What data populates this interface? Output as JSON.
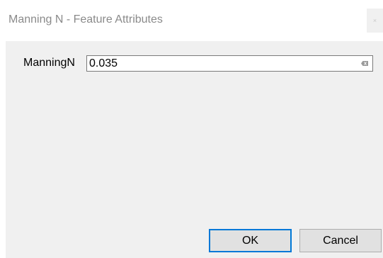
{
  "window": {
    "title": "Manning N - Feature Attributes",
    "close_glyph": "×"
  },
  "form": {
    "field_label": "ManningN",
    "field_value": "0.035",
    "clear_icon": "backspace-icon"
  },
  "buttons": {
    "ok_label": "OK",
    "cancel_label": "Cancel"
  },
  "colors": {
    "focus_border": "#0078d7",
    "dialog_background": "#f0f0f0"
  }
}
